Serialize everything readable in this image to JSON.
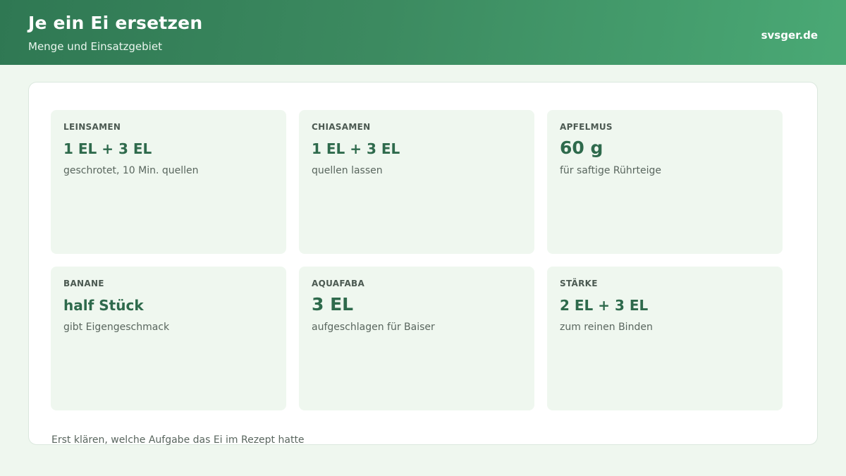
{
  "header": {
    "title": "Je ein Ei ersetzen",
    "subtitle": "Menge und Einsatzgebiet",
    "brand": "svsger.de"
  },
  "cards": [
    {
      "label": "LEINSAMEN",
      "amount": "1 EL + 3 EL",
      "note": "geschrotet, 10 Min. quellen"
    },
    {
      "label": "CHIASAMEN",
      "amount": "1 EL + 3 EL",
      "note": "quellen lassen"
    },
    {
      "label": "APFELMUS",
      "amount": "60 g",
      "note": "für saftige Rührteige"
    },
    {
      "label": "BANANE",
      "amount": "half Stück",
      "note": "gibt Eigengeschmack"
    },
    {
      "label": "AQUAFABA",
      "amount": "3 EL",
      "note": "aufgeschlagen für Baiser"
    },
    {
      "label": "STÄRKE",
      "amount": "2 EL + 3 EL",
      "note": "zum reinen Binden"
    }
  ],
  "footer": {
    "note": "Erst klären, welche Aufgabe das Ei im Rezept hatte"
  },
  "colors": {
    "header_start": "#2f7853",
    "header_end": "#4aa975",
    "accent": "#2e6a4c",
    "card_bg": "#eff7ef"
  }
}
